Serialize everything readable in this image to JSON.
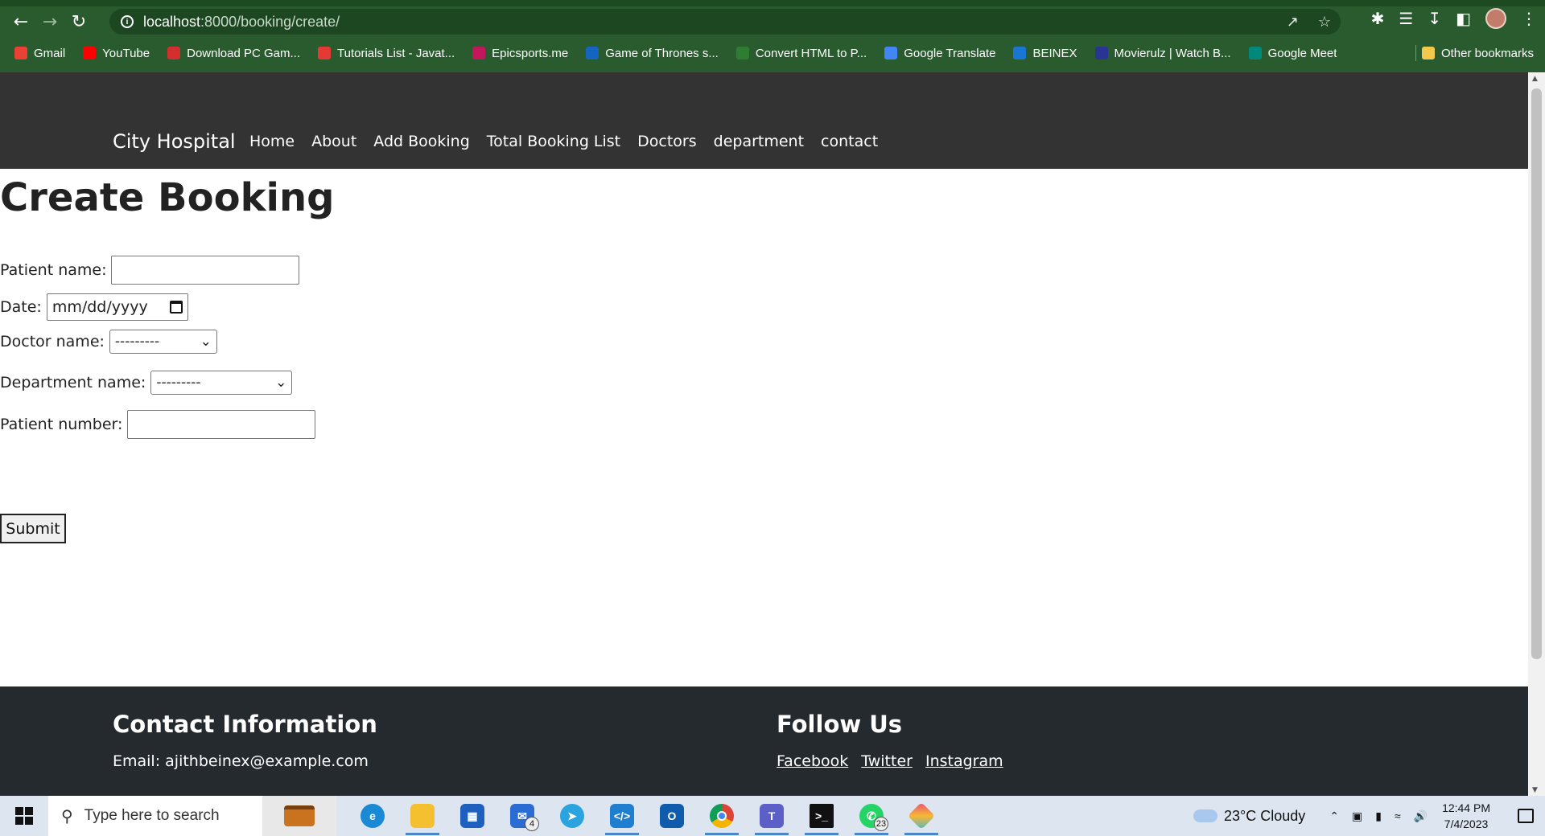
{
  "browser": {
    "url_host": "localhost",
    "url_path": ":8000/booking/create/",
    "bookmarks": [
      {
        "label": "Gmail",
        "icon": "gmail-icon",
        "color": "#e94235"
      },
      {
        "label": "YouTube",
        "icon": "youtube-icon",
        "color": "#ff0000"
      },
      {
        "label": "Download PC Gam...",
        "icon": "game-icon",
        "color": "#d32f2f"
      },
      {
        "label": "Tutorials List - Javat...",
        "icon": "javatpoint-icon",
        "color": "#e53935"
      },
      {
        "label": "Epicsports.me",
        "icon": "epicsports-icon",
        "color": "#c2185b"
      },
      {
        "label": "Game of Thrones s...",
        "icon": "globe-icon",
        "color": "#1565c0"
      },
      {
        "label": "Convert HTML to P...",
        "icon": "convert-icon",
        "color": "#2e7d32"
      },
      {
        "label": "Google Translate",
        "icon": "translate-icon",
        "color": "#4285f4"
      },
      {
        "label": "BEINEX",
        "icon": "beinex-icon",
        "color": "#1976d2"
      },
      {
        "label": "Movierulz | Watch B...",
        "icon": "movie-icon",
        "color": "#283593"
      },
      {
        "label": "Google Meet",
        "icon": "meet-icon",
        "color": "#00897b"
      }
    ],
    "other_bookmarks": "Other bookmarks"
  },
  "site": {
    "brand": "City Hospital",
    "nav": [
      "Home",
      "About",
      "Add Booking",
      "Total Booking List",
      "Doctors",
      "department",
      "contact"
    ]
  },
  "form": {
    "title": "Create Booking",
    "patient_name_label": "Patient name:",
    "date_label": "Date:",
    "date_placeholder": "mm/dd/yyyy",
    "doctor_label": "Doctor name:",
    "doctor_selected": "---------",
    "department_label": "Department name:",
    "department_selected": "---------",
    "patient_number_label": "Patient number:",
    "submit_label": "Submit"
  },
  "footer": {
    "contact_title": "Contact Information",
    "email": "Email: ajithbeinex@example.com",
    "follow_title": "Follow Us",
    "social": [
      "Facebook",
      "Twitter",
      "Instagram"
    ]
  },
  "taskbar": {
    "search_placeholder": "Type here to search",
    "weather": "23°C  Cloudy",
    "time": "12:44 PM",
    "date": "7/4/2023",
    "mail_badge": "4",
    "whatsapp_badge": "23"
  }
}
